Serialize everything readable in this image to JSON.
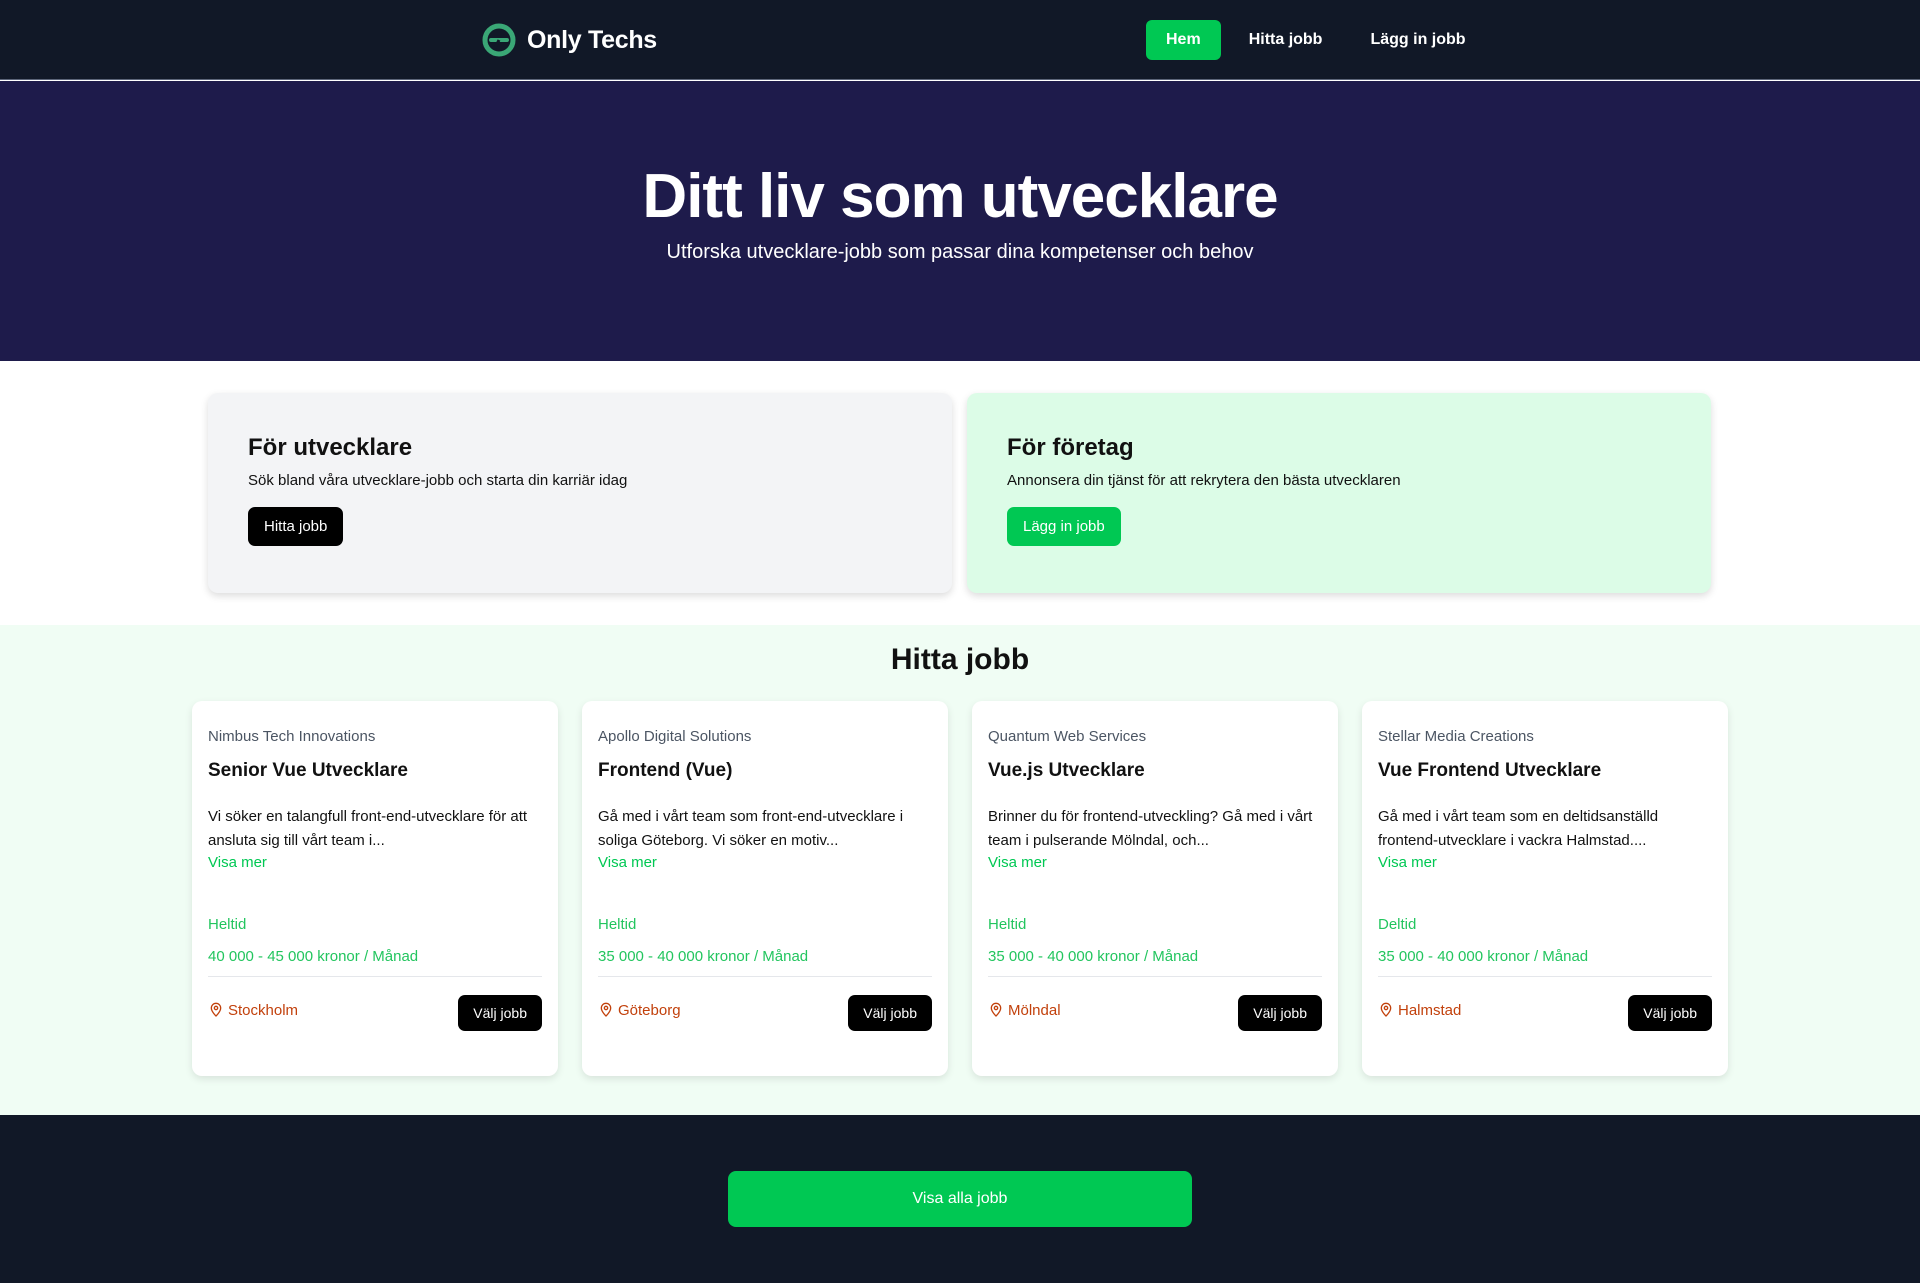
{
  "nav": {
    "brand": "Only Techs",
    "links": [
      {
        "label": "Hem",
        "active": true
      },
      {
        "label": "Hitta jobb",
        "active": false
      },
      {
        "label": "Lägg in jobb",
        "active": false
      }
    ]
  },
  "hero": {
    "title": "Ditt liv som utvecklare",
    "subtitle": "Utforska utvecklare-jobb som passar dina kompetenser och behov"
  },
  "cta": {
    "developers": {
      "title": "För utvecklare",
      "text": "Sök bland våra utvecklare-jobb och starta din karriär idag",
      "button": "Hitta jobb"
    },
    "companies": {
      "title": "För företag",
      "text": "Annonsera din tjänst för att rekrytera den bästa utvecklaren",
      "button": "Lägg in jobb"
    }
  },
  "jobs": {
    "title": "Hitta jobb",
    "items": [
      {
        "company": "Nimbus Tech Innovations",
        "title": "Senior Vue Utvecklare",
        "description": "Vi söker en talangfull front-end-utvecklare för att ansluta sig till vårt team i...",
        "show_more": "Visa mer",
        "type": "Heltid",
        "salary": "40 000 - 45 000 kronor / Månad",
        "location": "Stockholm",
        "button": "Välj jobb"
      },
      {
        "company": "Apollo Digital Solutions",
        "title": "Frontend (Vue)",
        "description": "Gå med i vårt team som front-end-utvecklare i soliga Göteborg. Vi söker en motiv...",
        "show_more": "Visa mer",
        "type": "Heltid",
        "salary": "35 000 - 40 000 kronor / Månad",
        "location": "Göteborg",
        "button": "Välj jobb"
      },
      {
        "company": "Quantum Web Services",
        "title": "Vue.js Utvecklare",
        "description": "Brinner du för frontend-utveckling? Gå med i vårt team i pulserande Mölndal, och...",
        "show_more": "Visa mer",
        "type": "Heltid",
        "salary": "35 000 - 40 000 kronor / Månad",
        "location": "Mölndal",
        "button": "Välj jobb"
      },
      {
        "company": "Stellar Media Creations",
        "title": "Vue Frontend Utvecklare",
        "description": "Gå med i vårt team som en deltidsanställd frontend-utvecklare i vackra Halmstad....",
        "show_more": "Visa mer",
        "type": "Deltid",
        "salary": "35 000 - 40 000 kronor / Månad",
        "location": "Halmstad",
        "button": "Välj jobb"
      }
    ]
  },
  "footer": {
    "view_all": "Visa alla jobb"
  },
  "icons": {
    "logo": "logo-icon",
    "location": "map-pin-icon"
  },
  "colors": {
    "nav_bg": "#111827",
    "hero_bg": "#1e1b4b",
    "accent_green": "#00c853",
    "location_orange": "#c2410c"
  }
}
